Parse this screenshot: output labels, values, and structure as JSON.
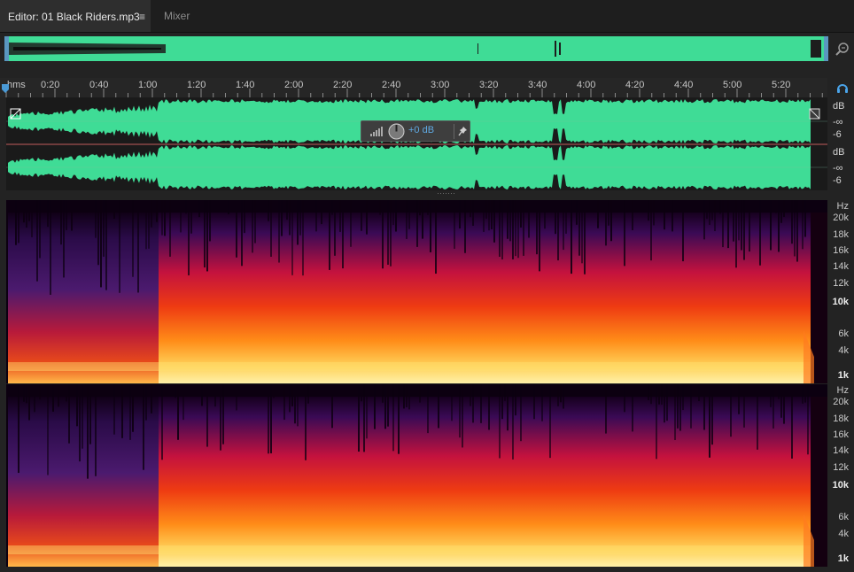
{
  "tabs": {
    "editor_label": "Editor: 01 Black Riders.mp3",
    "editor_menu_icon": "≡",
    "mixer_label": "Mixer"
  },
  "ruler": {
    "unit": "hms",
    "labels": [
      "0:20",
      "0:40",
      "1:00",
      "1:20",
      "1:40",
      "2:00",
      "2:20",
      "2:40",
      "3:00",
      "3:20",
      "3:40",
      "4:00",
      "4:20",
      "4:40",
      "5:00",
      "5:20"
    ]
  },
  "waveform": {
    "color": "#3fdc96",
    "db_top": {
      "unit": "dB",
      "inf": "-∞",
      "minus6": "-6"
    },
    "db_bottom": {
      "unit": "dB",
      "inf": "-∞",
      "minus6": "-6"
    }
  },
  "hud": {
    "volume": "+0 dB",
    "pin_icon": "pin-icon",
    "level_icon": "level-bars-icon",
    "knob_icon": "volume-knob-icon"
  },
  "spectral": {
    "top": {
      "unit": "Hz",
      "labels": [
        "20k",
        "18k",
        "16k",
        "14k",
        "12k",
        "10k",
        "6k",
        "4k",
        "1k"
      ],
      "bold": [
        "10k",
        "1k"
      ]
    },
    "bottom": {
      "unit": "Hz",
      "labels": [
        "20k",
        "18k",
        "16k",
        "14k",
        "12k",
        "10k",
        "6k",
        "4k",
        "1k"
      ],
      "bold": [
        "10k",
        "1k"
      ]
    }
  },
  "icons": {
    "zoom": "zoom-icon",
    "headphones": "headphones-icon",
    "playhead": "playhead-marker-icon"
  }
}
